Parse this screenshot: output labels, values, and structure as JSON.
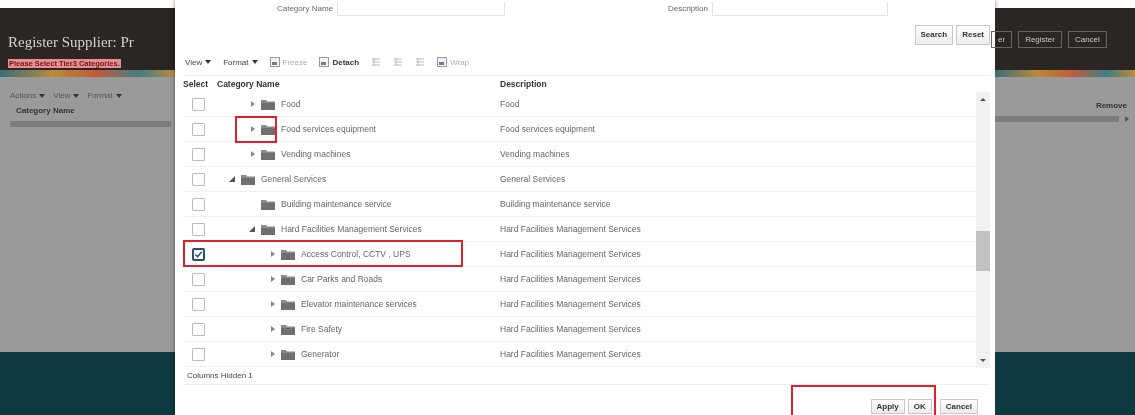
{
  "background": {
    "title": "Register Supplier: Pr",
    "message": "Please Select Tier3 Categories.",
    "menus": [
      "Actions",
      "View",
      "Format"
    ],
    "left_column": "Category Name",
    "buttons": [
      "er",
      "Register",
      "Cancel"
    ],
    "right_column": "Remove"
  },
  "dialog": {
    "search": {
      "fields": [
        {
          "label": "Category Name"
        },
        {
          "label": "Description"
        }
      ],
      "buttons": [
        "Search",
        "Reset"
      ]
    },
    "toolbar": [
      {
        "kind": "menu",
        "label": "View",
        "disabled": false
      },
      {
        "kind": "menu",
        "label": "Format",
        "disabled": false
      },
      {
        "kind": "button",
        "label": "Freeze",
        "disabled": true
      },
      {
        "kind": "button",
        "label": "Detach",
        "disabled": false
      },
      {
        "kind": "icon",
        "disabled": true
      },
      {
        "kind": "icon",
        "disabled": true
      },
      {
        "kind": "icon",
        "disabled": true
      },
      {
        "kind": "button",
        "label": "Wrap",
        "disabled": true
      }
    ],
    "columns": [
      "Select",
      "Category Name",
      "Description"
    ],
    "rows": [
      {
        "children": [
          {
            "name": "Food",
            "description": "Food",
            "kind": "branch",
            "expanded": false,
            "checked": false,
            "icons_highlighted": false,
            "row_highlighted": false
          },
          {
            "name": "Food services equipment",
            "description": "Food services equipment",
            "kind": "branch",
            "expanded": false,
            "checked": false,
            "icons_highlighted": true,
            "row_highlighted": false
          },
          {
            "name": "Vending machines",
            "description": "Vending machines",
            "kind": "branch",
            "expanded": false,
            "checked": false,
            "icons_highlighted": false,
            "row_highlighted": false
          }
        ]
      },
      {
        "name": "General Services",
        "description": "General Services",
        "kind": "branch",
        "expanded": true,
        "checked": false,
        "icons_highlighted": false,
        "row_highlighted": false,
        "children": [
          {
            "name": "Building maintenance service",
            "description": "Building maintenance service",
            "kind": "leaf",
            "checked": false,
            "icons_highlighted": false,
            "row_highlighted": false
          },
          {
            "name": "Hard Facilities Management Services",
            "description": "Hard Facilities Management Services",
            "kind": "branch",
            "expanded": true,
            "checked": false,
            "icons_highlighted": false,
            "row_highlighted": false,
            "children": [
              {
                "name": "Access Control, CCTV , UPS",
                "description": "Hard Facilities Management Services",
                "kind": "branch",
                "expanded": false,
                "checked": true,
                "icons_highlighted": false,
                "row_highlighted": true
              },
              {
                "name": "Car Parks and Roads",
                "description": "Hard Facilities Management Services",
                "kind": "branch",
                "expanded": false,
                "checked": false,
                "icons_highlighted": false,
                "row_highlighted": false
              },
              {
                "name": "Elevator maintenance services",
                "description": "Hard Facilities Management Services",
                "kind": "branch",
                "expanded": false,
                "checked": false,
                "icons_highlighted": false,
                "row_highlighted": false
              },
              {
                "name": "Fire Safety",
                "description": "Hard Facilities Management Services",
                "kind": "branch",
                "expanded": false,
                "checked": false,
                "icons_highlighted": false,
                "row_highlighted": false
              },
              {
                "name": "Generator",
                "description": "Hard Facilities Management Services",
                "kind": "branch",
                "expanded": false,
                "checked": false,
                "icons_highlighted": false,
                "row_highlighted": false
              }
            ]
          }
        ]
      }
    ],
    "status": "Columns Hidden 1",
    "buttons": [
      {
        "label": "Apply",
        "highlight": true
      },
      {
        "label": "OK",
        "highlight": true
      },
      {
        "label": "Cancel",
        "highlight": false
      }
    ]
  }
}
